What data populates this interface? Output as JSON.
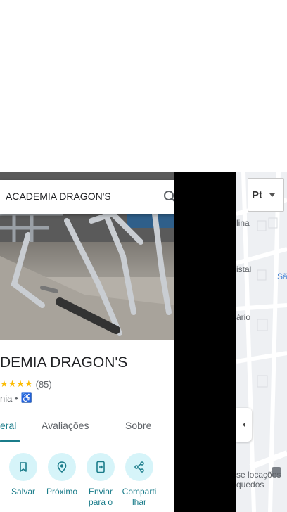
{
  "search": {
    "query": "ACADEMIA DRAGON'S"
  },
  "place": {
    "title": "DEMIA DRAGON'S",
    "stars": "★★★★",
    "reviews": "(85)",
    "category": "nia •",
    "accessibility_icon": "wheelchair-icon"
  },
  "tabs": [
    {
      "label": "eral"
    },
    {
      "label": "Avaliações"
    },
    {
      "label": "Sobre"
    }
  ],
  "actions": [
    {
      "label": "Salvar",
      "icon": "bookmark-icon"
    },
    {
      "label": "Próximo",
      "icon": "nearby-icon"
    },
    {
      "label": "Enviar para o",
      "icon": "send-to-phone-icon"
    },
    {
      "label": "Comparti lhar",
      "icon": "share-icon"
    }
  ],
  "map": {
    "labels": [
      "lina",
      "istal",
      "Sã",
      "ário",
      "se locações",
      "quedos"
    ],
    "layer_button_glyph": "Pt"
  },
  "colors": {
    "accent": "#1a7c8a",
    "action_bg": "#d6f4f9",
    "star": "#fbbc04"
  }
}
